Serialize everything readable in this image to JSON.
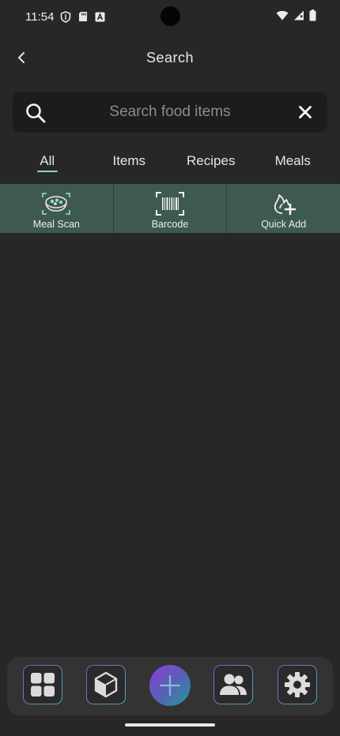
{
  "status_bar": {
    "time": "11:54"
  },
  "header": {
    "title": "Search"
  },
  "search": {
    "placeholder": "Search food items",
    "value": ""
  },
  "tabs": [
    {
      "label": "All",
      "active": true
    },
    {
      "label": "Items",
      "active": false
    },
    {
      "label": "Recipes",
      "active": false
    },
    {
      "label": "Meals",
      "active": false
    }
  ],
  "actions": [
    {
      "label": "Meal Scan",
      "icon": "meal-scan-icon"
    },
    {
      "label": "Barcode",
      "icon": "barcode-icon"
    },
    {
      "label": "Quick Add",
      "icon": "quick-add-icon"
    }
  ],
  "bottom_nav": [
    {
      "icon": "dashboard-grid-icon"
    },
    {
      "icon": "cube-icon"
    },
    {
      "icon": "plus-icon"
    },
    {
      "icon": "people-icon"
    },
    {
      "icon": "gear-icon"
    }
  ],
  "colors": {
    "background": "#272727",
    "accent_teal": "#8fd6c0",
    "action_row": "#3e5a50",
    "gradient_purple": "#8a3fd4",
    "gradient_teal": "#1d9b95"
  }
}
